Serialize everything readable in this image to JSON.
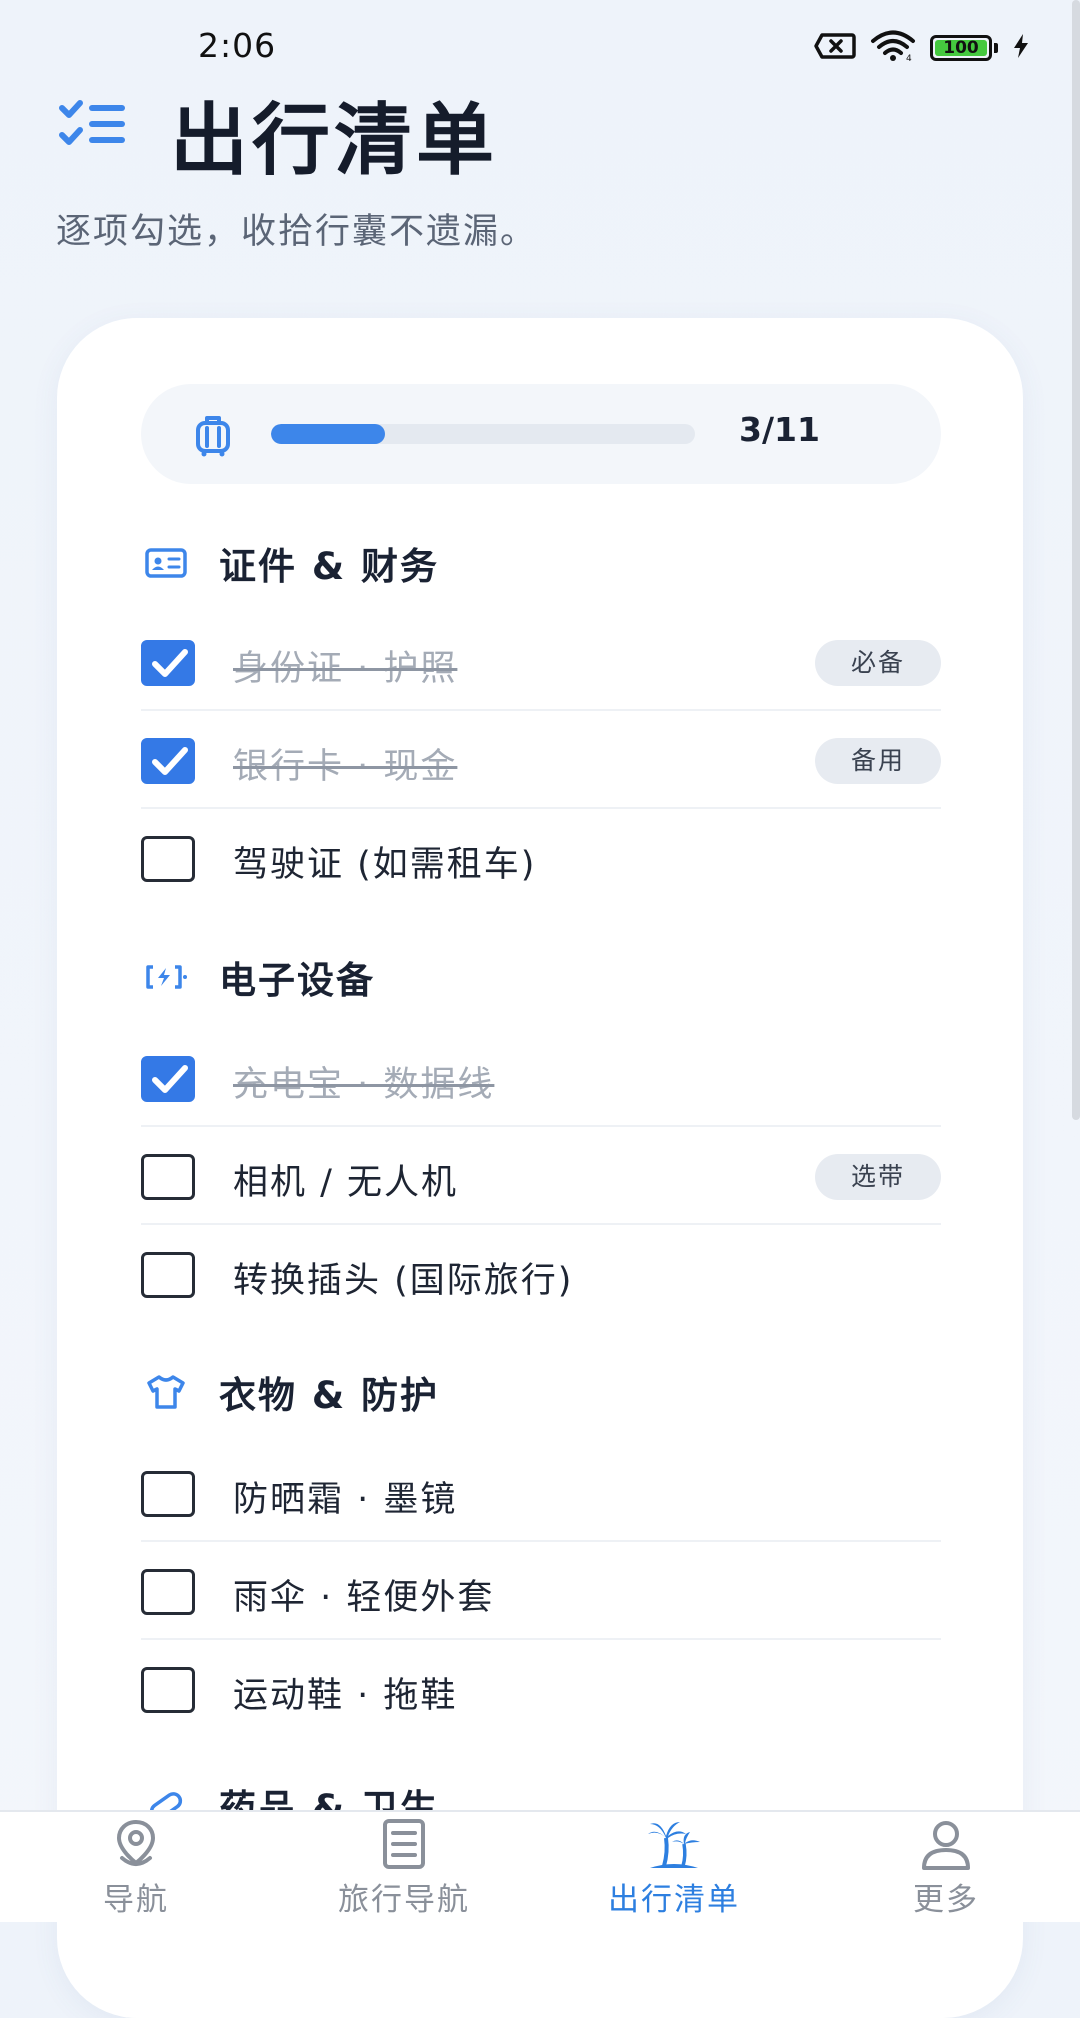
{
  "status_bar": {
    "time": "2:06",
    "battery_level": "100"
  },
  "header": {
    "title": "出行清单",
    "subtitle": "逐项勾选，收拾行囊不遗漏。"
  },
  "progress": {
    "count_text": "3/11",
    "completed": 3,
    "total": 11,
    "fill_fraction": 0.27
  },
  "sections": [
    {
      "title": "证件 & 财务",
      "icon": "id-card-icon",
      "items": [
        {
          "label": "身份证 · 护照",
          "checked": true,
          "tag": "必备"
        },
        {
          "label": "银行卡 · 现金",
          "checked": true,
          "tag": "备用"
        },
        {
          "label": "驾驶证 (如需租车)",
          "checked": false,
          "tag": ""
        }
      ]
    },
    {
      "title": "电子设备",
      "icon": "charging-icon",
      "items": [
        {
          "label": "充电宝 · 数据线",
          "checked": true,
          "tag": ""
        },
        {
          "label": "相机 / 无人机",
          "checked": false,
          "tag": "选带"
        },
        {
          "label": "转换插头 (国际旅行)",
          "checked": false,
          "tag": ""
        }
      ]
    },
    {
      "title": "衣物 & 防护",
      "icon": "tshirt-icon",
      "items": [
        {
          "label": "防晒霜 · 墨镜",
          "checked": false,
          "tag": ""
        },
        {
          "label": "雨伞 · 轻便外套",
          "checked": false,
          "tag": ""
        },
        {
          "label": "运动鞋 · 拖鞋",
          "checked": false,
          "tag": ""
        }
      ]
    },
    {
      "title": "药品 & 卫生",
      "icon": "pill-icon"
    }
  ],
  "bottom_nav": [
    {
      "label": "导航",
      "icon": "location-pin-icon",
      "active": false
    },
    {
      "label": "旅行导航",
      "icon": "document-icon",
      "active": false
    },
    {
      "label": "出行清单",
      "icon": "palm-tree-icon",
      "active": true
    },
    {
      "label": "更多",
      "icon": "user-icon",
      "active": false
    }
  ],
  "colors": {
    "accent": "#3479E6",
    "active_nav": "#2D7FE0",
    "battery": "#45C93F"
  }
}
